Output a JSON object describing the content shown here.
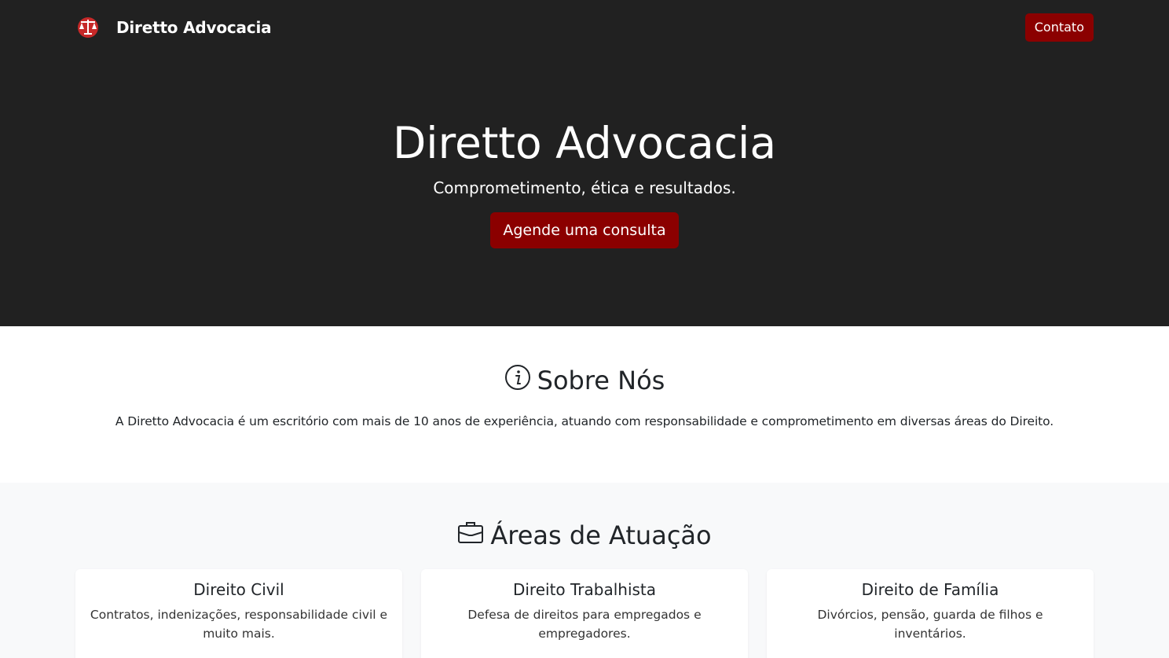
{
  "navbar": {
    "brand_name": "Diretto Advocacia",
    "logo_icon": "scales-of-justice-icon",
    "contact_label": "Contato"
  },
  "hero": {
    "title": "Diretto Advocacia",
    "subtitle": "Comprometimento, ética e resultados.",
    "cta_label": "Agende uma consulta"
  },
  "about": {
    "icon": "info-icon",
    "title": "Sobre Nós",
    "text": "A Diretto Advocacia é um escritório com mais de 10 anos de experiência, atuando com responsabilidade e comprometimento em diversas áreas do Direito."
  },
  "areas": {
    "icon": "briefcase-icon",
    "title": "Áreas de Atuação",
    "cards": [
      {
        "title": "Direito Civil",
        "text": "Contratos, indenizações, responsabilidade civil e muito mais."
      },
      {
        "title": "Direito Trabalhista",
        "text": "Defesa de direitos para empregados e empregadores."
      },
      {
        "title": "Direito de Família",
        "text": "Divórcios, pensão, guarda de filhos e inventários."
      }
    ]
  },
  "colors": {
    "dark_bg": "#212121",
    "accent": "#8b0000",
    "light_bg": "#f8f9fa"
  }
}
